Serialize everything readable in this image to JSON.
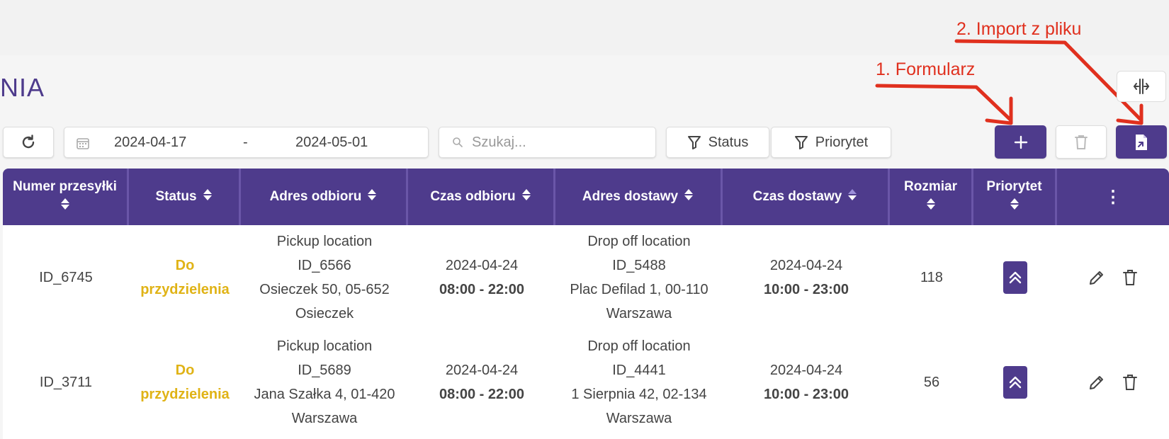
{
  "page": {
    "title": "NIA"
  },
  "annotations": {
    "form_label": "1. Formularz",
    "import_label": "2. Import z pliku",
    "color": "#e0301e"
  },
  "theme": {
    "accent": "#4e3b8c",
    "status_color": "#e0b316"
  },
  "toolbar": {
    "date_from": "2024-04-17",
    "date_separator": "-",
    "date_to": "2024-05-01",
    "search_placeholder": "Szukaj...",
    "filter_status_label": "Status",
    "filter_priority_label": "Priorytet",
    "add_symbol": "+"
  },
  "table": {
    "headers": [
      "Numer przesyłki",
      "Status",
      "Adres odbioru",
      "Czas odbioru",
      "Adres dostawy",
      "Czas dostawy",
      "Rozmiar",
      "Priorytet",
      "⋮"
    ],
    "rows": [
      {
        "id": "ID_6745",
        "status": [
          "Do",
          "przydzielenia"
        ],
        "pickup": [
          "Pickup location",
          "ID_6566",
          "Osieczek 50, 05-652",
          "Osieczek"
        ],
        "pickup_date": "2024-04-24",
        "pickup_time": "08:00 - 22:00",
        "dropoff": [
          "Drop off location",
          "ID_5488",
          "Plac Defilad 1, 00-110",
          "Warszawa"
        ],
        "dropoff_date": "2024-04-24",
        "dropoff_time": "10:00 - 23:00",
        "size": "118",
        "priority": "high"
      },
      {
        "id": "ID_3711",
        "status": [
          "Do",
          "przydzielenia"
        ],
        "pickup": [
          "Pickup location",
          "ID_5689",
          "Jana Szałka 4, 01-420",
          "Warszawa"
        ],
        "pickup_date": "2024-04-24",
        "pickup_time": "08:00 - 22:00",
        "dropoff": [
          "Drop off location",
          "ID_4441",
          "1 Sierpnia 42, 02-134",
          "Warszawa"
        ],
        "dropoff_date": "2024-04-24",
        "dropoff_time": "10:00 - 23:00",
        "size": "56",
        "priority": "high"
      }
    ]
  }
}
